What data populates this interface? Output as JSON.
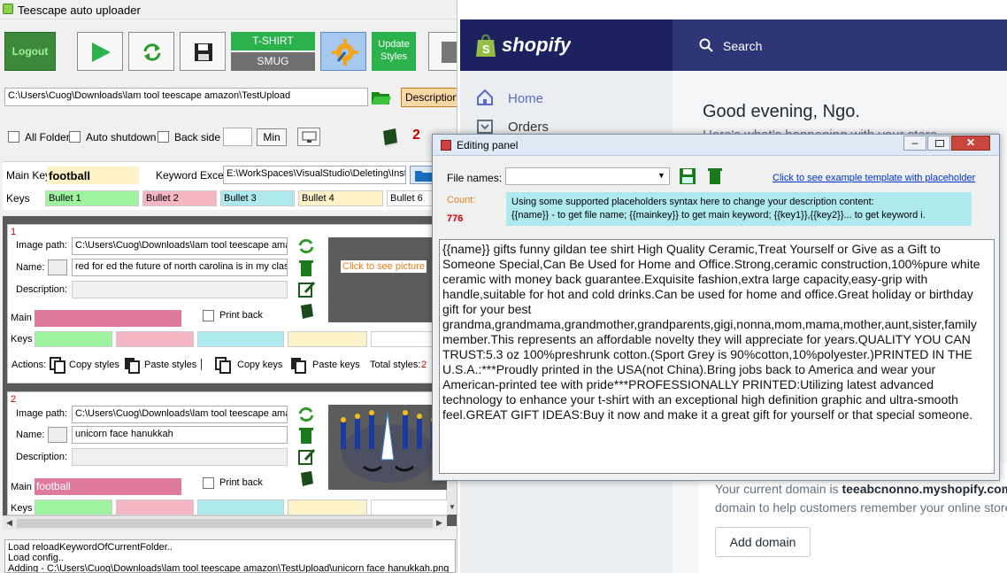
{
  "app": {
    "title": "Teescape auto uploader"
  },
  "toolbar": {
    "logout": "Logout",
    "tshirt": "T-SHIRT",
    "smug": "SMUG",
    "update_styles": "Update Styles"
  },
  "path": {
    "value": "C:\\Users\\Cuog\\Downloads\\lam tool teescape amazon\\TestUpload",
    "descriptions_btn": "Descriptions"
  },
  "options": {
    "all_folder": "All Folder",
    "auto_shutdown": "Auto shutdown",
    "back_side": "Back side",
    "min_btn": "Min",
    "count": "2"
  },
  "mainkey": {
    "label": "Main Key",
    "value": "football",
    "keyword_excel_label": "Keyword Excel",
    "keyword_excel_value": "E:\\WorkSpaces\\VisualStudio\\Deleting\\Insta"
  },
  "keys": {
    "label": "Keys",
    "items": [
      "Bullet 1",
      "Bullet 2",
      "Bullet 3",
      "Bullet 4",
      "Bullet 6"
    ]
  },
  "items": [
    {
      "index": "1",
      "image_path_label": "Image path:",
      "image_path": "C:\\Users\\Cuog\\Downloads\\lam tool teescape ama",
      "name_label": "Name:",
      "name": "red for ed the future of north carolina is in my classr",
      "description_label": "Description:",
      "description": "",
      "main_label": "Main",
      "main_value": "",
      "print_back": "Print back",
      "keys_label": "Keys",
      "preview_text": "Click to see picture"
    },
    {
      "index": "2",
      "image_path_label": "Image path:",
      "image_path": "C:\\Users\\Cuog\\Downloads\\lam tool teescape ama",
      "name_label": "Name:",
      "name": "unicorn face hanukkah",
      "description_label": "Description:",
      "description": "",
      "main_label": "Main",
      "main_value": "football",
      "print_back": "Print back",
      "keys_label": "Keys"
    }
  ],
  "actions": {
    "label": "Actions:",
    "copy_styles": "Copy styles",
    "paste_styles": "Paste styles",
    "copy_keys": "Copy keys",
    "paste_keys": "Paste keys",
    "total_styles": "Total styles:",
    "total_styles_value": "2"
  },
  "log": [
    "Load reloadKeywordOfCurrentFolder..",
    "Load config..",
    "Adding - C:\\Users\\Cuog\\Downloads\\lam tool teescape amazon\\TestUpload\\unicorn face hanukkah.png"
  ],
  "shopify": {
    "brand": "shopify",
    "search": "Search",
    "nav": [
      "Home",
      "Orders"
    ],
    "greeting": "Good evening, Ngo.",
    "subtitle": "Here's what's happening with your store",
    "domain_text_1": "Your current domain is",
    "domain_value": "teeabcnonno.myshopify.com.",
    "domain_text_2": "domain to help customers remember your online store",
    "add_domain": "Add domain"
  },
  "panel": {
    "title": "Editing panel",
    "file_names_label": "File names:",
    "file_names_value": "",
    "example_link": "Click to see example template with placeholder",
    "count_label": "Count:",
    "count_value": "776",
    "info_line1": "Using some supported placeholders syntax here to change your description content:",
    "info_line2": "{{name}} - to get file name; {{mainkey}} to get main keyword; {{key1}},{{key2}}... to get keyword i.",
    "description": "{{name}} gifts funny gildan tee shirt High Quality Ceramic,Treat Yourself or Give as a Gift to Someone Special,Can Be Used for Home and Office.Strong,ceramic construction,100%pure white ceramic with money back guarantee.Exquisite fashion,extra large capacity,easy-grip with handle,suitable for hot and cold drinks.Can be used for home and office.Great holiday or birthday gift for your best grandma,grandmama,grandmother,grandparents,gigi,nonna,mom,mama,mother,aunt,sister,family member.This represents an affordable novelty they will appreciate for years.QUALITY YOU CAN TRUST:5.3 oz 100%preshrunk cotton.(Sport Grey is 90%cotton,10%polyester.)PRINTED IN THE U.S.A.:***Proudly printed in the USA(not China).Bring jobs back to America and wear your American-printed tee with pride***PROFESSIONALLY PRINTED:Utilizing latest advanced technology to enhance your t-shirt with an exceptional high definition graphic and ultra-smooth feel.GREAT GIFT IDEAS:Buy it now and make it a great gift for yourself or that special someone."
  },
  "colors": {
    "green": "#2bb24c",
    "keys_green": "#9ef49e",
    "keys_pink": "#f4b6c2",
    "keys_cyan": "#aee9ef",
    "keys_yellow": "#fdf2c8",
    "main_pink": "#e07a9a",
    "shopify_dark": "#1c2260",
    "link_blue": "#0033cc"
  }
}
